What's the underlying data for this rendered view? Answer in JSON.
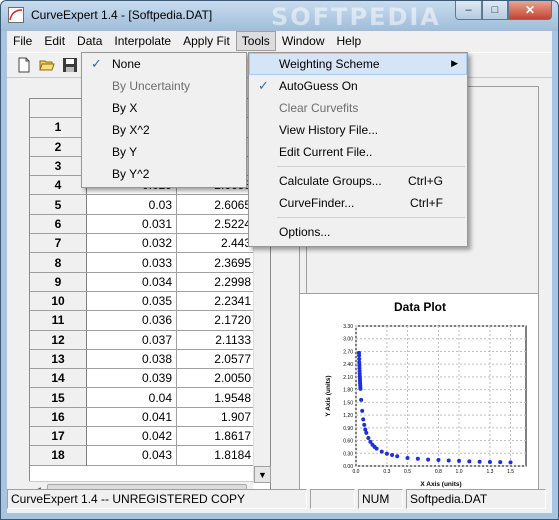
{
  "window": {
    "title": "CurveExpert 1.4 - [Softpedia.DAT]",
    "watermark": "SOFTPEDIA"
  },
  "caption_buttons": {
    "minimize": "–",
    "maximize": "□",
    "close": "✕"
  },
  "menubar": [
    "File",
    "Edit",
    "Data",
    "Interpolate",
    "Apply Fit",
    "Tools",
    "Window",
    "Help"
  ],
  "toolbar": [
    "new-icon",
    "open-icon",
    "save-icon"
  ],
  "weighting_menu": [
    {
      "label": "None",
      "checked": true,
      "enabled": true
    },
    {
      "label": "By Uncertainty",
      "checked": false,
      "enabled": false
    },
    {
      "label": "By X",
      "checked": false,
      "enabled": true
    },
    {
      "label": "By X^2",
      "checked": false,
      "enabled": true
    },
    {
      "label": "By Y",
      "checked": false,
      "enabled": true
    },
    {
      "label": "By Y^2",
      "checked": false,
      "enabled": true
    }
  ],
  "tools_menu": {
    "weighting_scheme": "Weighting Scheme",
    "autoguess": "AutoGuess On",
    "clear_curvefits": "Clear Curvefits",
    "view_history": "View History File...",
    "edit_current": "Edit Current File..",
    "calculate_groups": "Calculate Groups...",
    "calculate_groups_accel": "Ctrl+G",
    "curvefinder": "CurveFinder...",
    "curvefinder_accel": "Ctrl+F",
    "options": "Options..."
  },
  "grid": {
    "rows": [
      {
        "n": "1",
        "x": "",
        "y": ""
      },
      {
        "n": "2",
        "x": "",
        "y": ""
      },
      {
        "n": "3",
        "x": "",
        "y": ""
      },
      {
        "n": "4",
        "x": "0.029",
        "y": "2.6658"
      },
      {
        "n": "5",
        "x": "0.03",
        "y": "2.6065"
      },
      {
        "n": "6",
        "x": "0.031",
        "y": "2.5224"
      },
      {
        "n": "7",
        "x": "0.032",
        "y": "2.443"
      },
      {
        "n": "8",
        "x": "0.033",
        "y": "2.3695"
      },
      {
        "n": "9",
        "x": "0.034",
        "y": "2.2998"
      },
      {
        "n": "10",
        "x": "0.035",
        "y": "2.2341"
      },
      {
        "n": "11",
        "x": "0.036",
        "y": "2.1720"
      },
      {
        "n": "12",
        "x": "0.037",
        "y": "2.1133"
      },
      {
        "n": "13",
        "x": "0.038",
        "y": "2.0577"
      },
      {
        "n": "14",
        "x": "0.039",
        "y": "2.0050"
      },
      {
        "n": "15",
        "x": "0.04",
        "y": "1.9548"
      },
      {
        "n": "16",
        "x": "0.041",
        "y": "1.907"
      },
      {
        "n": "17",
        "x": "0.042",
        "y": "1.8617"
      },
      {
        "n": "18",
        "x": "0.043",
        "y": "1.8184"
      }
    ]
  },
  "status": {
    "message": "CurveExpert 1.4 -- UNREGISTERED COPY",
    "num": "NUM",
    "file": "Softpedia.DAT"
  },
  "chart_data": {
    "type": "scatter",
    "title": "Data Plot",
    "xlabel": "X Axis (units)",
    "ylabel": "Y Axis (units)",
    "xlim": [
      0.0,
      1.65
    ],
    "ylim": [
      0.0,
      3.3
    ],
    "xticks": [
      "0.0",
      "0.3",
      "0.5",
      "0.8",
      "1.0",
      "1.3",
      "1.5"
    ],
    "yticks": [
      "0.00",
      "0.30",
      "0.60",
      "0.90",
      "1.20",
      "1.50",
      "1.80",
      "2.10",
      "2.40",
      "2.70",
      "3.00",
      "3.30"
    ],
    "grid": true,
    "color": "#1f2fe0",
    "series": [
      {
        "x": [
          0.029,
          0.03,
          0.031,
          0.032,
          0.033,
          0.034,
          0.035,
          0.036,
          0.037,
          0.038,
          0.039,
          0.04,
          0.041,
          0.042,
          0.043,
          0.05,
          0.06,
          0.07,
          0.08,
          0.09,
          0.1,
          0.12,
          0.14,
          0.16,
          0.18,
          0.2,
          0.25,
          0.3,
          0.35,
          0.4,
          0.5,
          0.6,
          0.7,
          0.8,
          0.9,
          1.0,
          1.1,
          1.2,
          1.3,
          1.4,
          1.5
        ],
        "y": [
          2.6658,
          2.6065,
          2.5224,
          2.443,
          2.3695,
          2.2998,
          2.2341,
          2.172,
          2.1133,
          2.0577,
          2.005,
          1.9548,
          1.907,
          1.8617,
          1.8184,
          1.56,
          1.3,
          1.1,
          0.97,
          0.86,
          0.78,
          0.66,
          0.57,
          0.5,
          0.45,
          0.41,
          0.34,
          0.29,
          0.26,
          0.23,
          0.19,
          0.17,
          0.15,
          0.14,
          0.13,
          0.12,
          0.11,
          0.1,
          0.095,
          0.09,
          0.085
        ]
      }
    ]
  }
}
